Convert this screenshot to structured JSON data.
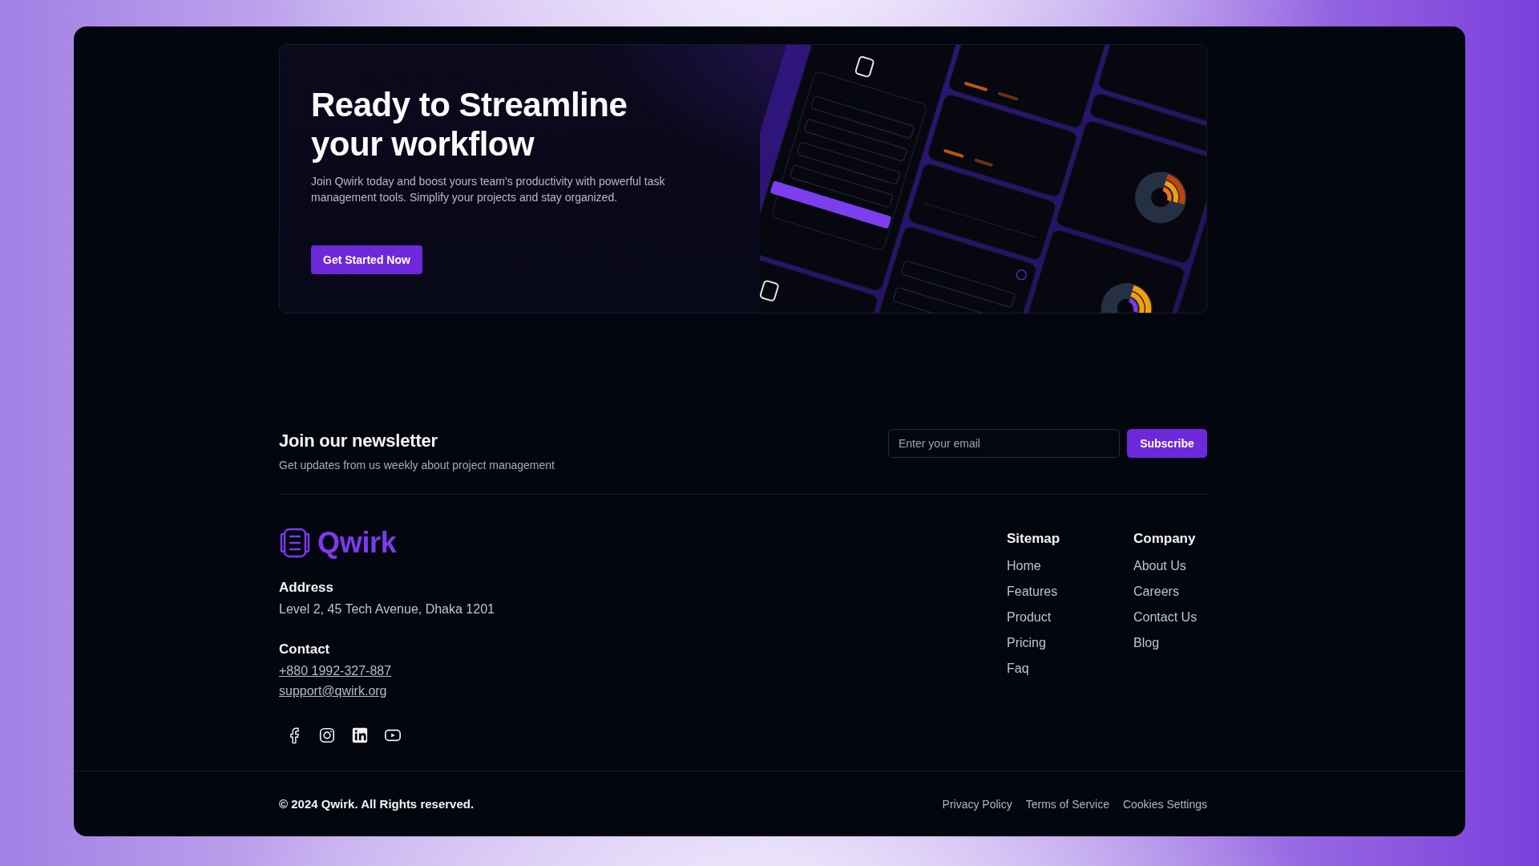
{
  "cta_banner": {
    "title": "Ready to Streamline your workflow",
    "description": "Join Qwirk today and boost yours team's productivity with powerful task management tools. Simplify your projects and stay organized.",
    "button": "Get Started Now"
  },
  "newsletter": {
    "title": "Join our newsletter",
    "subtitle": "Get updates from us weekly about project management",
    "email_field": {
      "placeholder": "Enter your email"
    },
    "button": "Subscribe"
  },
  "footer": {
    "logo": {
      "text": "Qwirk"
    },
    "address": {
      "label": "Address",
      "value": "Level 2, 45 Tech Avenue, Dhaka 1201"
    },
    "contact": {
      "label": "Contact",
      "phone": "+880 1992-327-887",
      "email": "support@qwirk.org"
    },
    "social_links": [
      {
        "kind": "facebook"
      },
      {
        "kind": "instagram"
      },
      {
        "kind": "linkedin"
      },
      {
        "kind": "youtube"
      }
    ],
    "columns": [
      {
        "title": "Sitemap",
        "links": [
          "Home",
          "Features",
          "Product",
          "Pricing",
          "Faq"
        ]
      },
      {
        "title": "Company",
        "links": [
          "About Us",
          "Careers",
          "Contact Us",
          "Blog"
        ]
      }
    ]
  },
  "bottom_bar": {
    "copyright": "© 2024 Qwirk. All Rights reserved.",
    "links": [
      "Privacy Policy",
      "Terms of Service",
      "Cookies Settings"
    ]
  }
}
